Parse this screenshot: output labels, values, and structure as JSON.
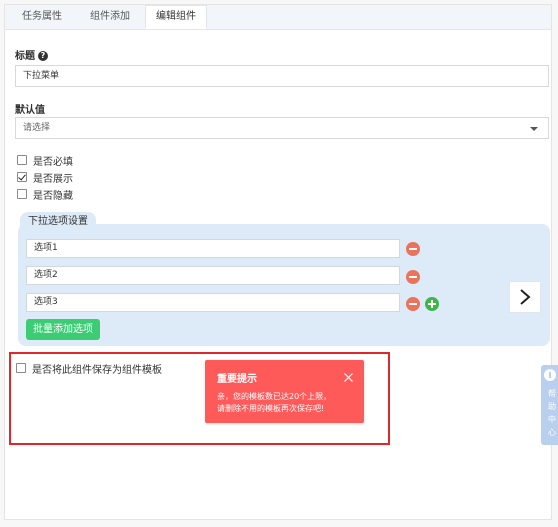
{
  "tabs": [
    {
      "label": "任务属性"
    },
    {
      "label": "组件添加"
    },
    {
      "label": "编辑组件"
    }
  ],
  "title_field": {
    "label": "标题",
    "value": "下拉菜单"
  },
  "default_field": {
    "label": "默认值",
    "placeholder": "请选择"
  },
  "checkboxes": [
    {
      "label": "是否必填",
      "checked": false
    },
    {
      "label": "是否展示",
      "checked": true
    },
    {
      "label": "是否隐藏",
      "checked": false
    }
  ],
  "options_section": {
    "title": "下拉选项设置",
    "options": [
      "选项1",
      "选项2",
      "选项3"
    ],
    "batch_button": "批量添加选项"
  },
  "template_checkbox": {
    "label": "是否将此组件保存为组件模板",
    "checked": false
  },
  "toast": {
    "title": "重要提示",
    "line1": "亲，您的模板数已达20个上限，",
    "line2": "请删除不用的模板再次保存吧!"
  },
  "side_float": {
    "chars": [
      "帮",
      "助",
      "中",
      "心"
    ]
  },
  "colors": {
    "toast_bg": "#ff5a5a",
    "batch_button": "#3ccc74",
    "remove_button": "#ec7359",
    "add_button": "#3fb54a",
    "options_bg": "#ddeaf8",
    "highlight_border": "#e0282a"
  }
}
